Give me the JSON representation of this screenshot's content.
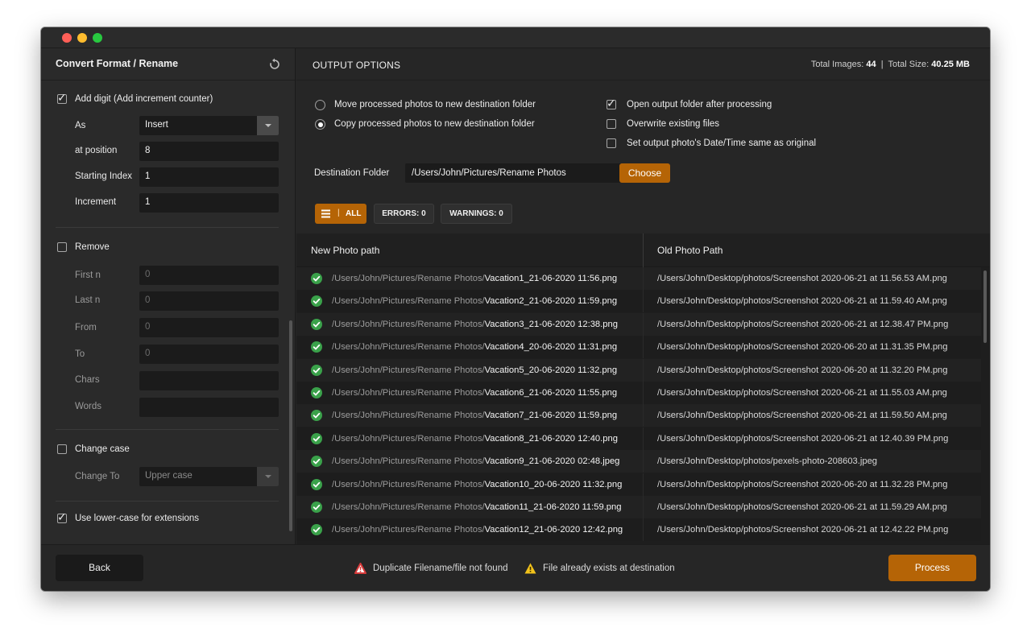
{
  "sidebar": {
    "title": "Convert Format / Rename",
    "add_digit": {
      "label": "Add digit (Add increment counter)",
      "checked": true
    },
    "as": {
      "label": "As",
      "value": "Insert"
    },
    "at_position": {
      "label": "at position",
      "value": "8"
    },
    "starting_index": {
      "label": "Starting Index",
      "value": "1"
    },
    "increment": {
      "label": "Increment",
      "value": "1"
    },
    "remove": {
      "label": "Remove",
      "checked": false
    },
    "first_n": {
      "label": "First n",
      "value": "0"
    },
    "last_n": {
      "label": "Last n",
      "value": "0"
    },
    "from": {
      "label": "From",
      "value": "0"
    },
    "to": {
      "label": "To",
      "value": "0"
    },
    "chars": {
      "label": "Chars",
      "value": ""
    },
    "words": {
      "label": "Words",
      "value": ""
    },
    "change_case": {
      "label": "Change case",
      "checked": false
    },
    "change_to": {
      "label": "Change To",
      "value": "Upper case"
    },
    "lowercase_ext": {
      "label": "Use lower-case for extensions",
      "checked": true
    }
  },
  "output": {
    "title": "OUTPUT OPTIONS",
    "total_images_label": "Total Images:",
    "total_images": "44",
    "separator": "|",
    "total_size_label": "Total Size:",
    "total_size": "40.25 MB",
    "move_option": "Move processed photos to new destination folder",
    "copy_option": "Copy processed photos to new destination folder",
    "selected_mode": "copy",
    "open_folder": {
      "label": "Open output folder after processing",
      "checked": true
    },
    "overwrite": {
      "label": "Overwrite existing files",
      "checked": false
    },
    "same_datetime": {
      "label": "Set output photo's Date/Time same as original",
      "checked": false
    },
    "destination_label": "Destination Folder",
    "destination_value": "/Users/John/Pictures/Rename Photos",
    "choose_label": "Choose"
  },
  "filters": {
    "all_sep": "|",
    "all": "ALL",
    "errors": "ERRORS: 0",
    "warnings": "WARNINGS: 0"
  },
  "table": {
    "col_new": "New Photo path",
    "col_old": "Old Photo Path",
    "rows": [
      {
        "dir": "/Users/John/Pictures/Rename Photos/",
        "file": "Vacation1_21-06-2020 11:56.png",
        "old": "/Users/John/Desktop/photos/Screenshot 2020-06-21 at 11.56.53 AM.png"
      },
      {
        "dir": "/Users/John/Pictures/Rename Photos/",
        "file": "Vacation2_21-06-2020 11:59.png",
        "old": "/Users/John/Desktop/photos/Screenshot 2020-06-21 at 11.59.40 AM.png"
      },
      {
        "dir": "/Users/John/Pictures/Rename Photos/",
        "file": "Vacation3_21-06-2020 12:38.png",
        "old": "/Users/John/Desktop/photos/Screenshot 2020-06-21 at 12.38.47 PM.png"
      },
      {
        "dir": "/Users/John/Pictures/Rename Photos/",
        "file": "Vacation4_20-06-2020 11:31.png",
        "old": "/Users/John/Desktop/photos/Screenshot 2020-06-20 at 11.31.35 PM.png"
      },
      {
        "dir": "/Users/John/Pictures/Rename Photos/",
        "file": "Vacation5_20-06-2020 11:32.png",
        "old": "/Users/John/Desktop/photos/Screenshot 2020-06-20 at 11.32.20 PM.png"
      },
      {
        "dir": "/Users/John/Pictures/Rename Photos/",
        "file": "Vacation6_21-06-2020 11:55.png",
        "old": "/Users/John/Desktop/photos/Screenshot 2020-06-21 at 11.55.03 AM.png"
      },
      {
        "dir": "/Users/John/Pictures/Rename Photos/",
        "file": "Vacation7_21-06-2020 11:59.png",
        "old": "/Users/John/Desktop/photos/Screenshot 2020-06-21 at 11.59.50 AM.png"
      },
      {
        "dir": "/Users/John/Pictures/Rename Photos/",
        "file": "Vacation8_21-06-2020 12:40.png",
        "old": "/Users/John/Desktop/photos/Screenshot 2020-06-21 at 12.40.39 PM.png"
      },
      {
        "dir": "/Users/John/Pictures/Rename Photos/",
        "file": "Vacation9_21-06-2020 02:48.jpeg",
        "old": "/Users/John/Desktop/photos/pexels-photo-208603.jpeg"
      },
      {
        "dir": "/Users/John/Pictures/Rename Photos/",
        "file": "Vacation10_20-06-2020 11:32.png",
        "old": "/Users/John/Desktop/photos/Screenshot 2020-06-20 at 11.32.28 PM.png"
      },
      {
        "dir": "/Users/John/Pictures/Rename Photos/",
        "file": "Vacation11_21-06-2020 11:59.png",
        "old": "/Users/John/Desktop/photos/Screenshot 2020-06-21 at 11.59.29 AM.png"
      },
      {
        "dir": "/Users/John/Pictures/Rename Photos/",
        "file": "Vacation12_21-06-2020 12:42.png",
        "old": "/Users/John/Desktop/photos/Screenshot 2020-06-21 at 12.42.22 PM.png"
      }
    ]
  },
  "footer": {
    "back": "Back",
    "legend_error": "Duplicate Filename/file not found",
    "legend_warning": "File already exists at destination",
    "process": "Process"
  },
  "colors": {
    "accent": "#b56406",
    "success": "#3aa14a",
    "error": "#d83a3a",
    "warning": "#f2c21b"
  }
}
